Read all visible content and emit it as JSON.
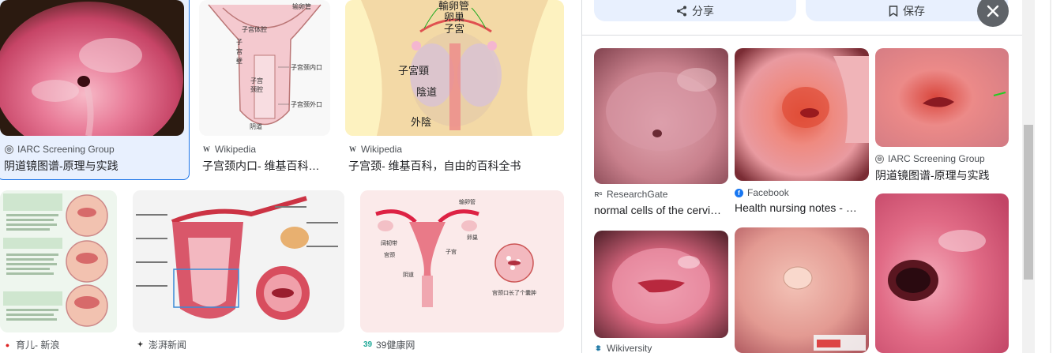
{
  "results": [
    {
      "source": "IARC Screening Group",
      "title": "阴道镜图谱-原理与实践",
      "source_icon": "globe-icon"
    },
    {
      "source": "Wikipedia",
      "title": "子宫颈内口- 维基百科…",
      "source_icon": "wikipedia-icon",
      "labels": [
        "输卵管",
        "子宫体腔",
        "子",
        "宫",
        "壁",
        "子宫颈内口",
        "子",
        "宫",
        "颈",
        "腔",
        "子宫颈外口",
        "阴道"
      ]
    },
    {
      "source": "Wikipedia",
      "title": "子宫颈- 维基百科，自由的百科全书",
      "source_icon": "wikipedia-icon",
      "labels": [
        "輸卵管",
        "卵巢",
        "子宮",
        "子宮頸",
        "陰道",
        "外陰"
      ]
    },
    {
      "source": "育儿- 新浪",
      "title": "",
      "source_icon": "sina-icon"
    },
    {
      "source": "澎湃新闻",
      "title": "",
      "source_icon": "thepaper-icon"
    },
    {
      "source": "39健康网",
      "title": "",
      "source_icon": "39-icon",
      "labels": [
        "输卵管",
        "卵巢",
        "阔韧带",
        "宫颈",
        "阴道",
        "子宫",
        "宫颈口长了个囊肿"
      ]
    }
  ],
  "panel": {
    "share_label": "分享",
    "save_label": "保存",
    "related": [
      {
        "source": "ResearchGate",
        "title": "normal cells of the cervi…",
        "source_icon": "researchgate-icon"
      },
      {
        "source": "Facebook",
        "title": "Health nursing notes - …",
        "source_icon": "facebook-icon"
      },
      {
        "source": "IARC Screening Group",
        "title": "阴道镜图谱-原理与实践",
        "source_icon": "globe-icon"
      },
      {
        "source": "Wikiversity",
        "title": "",
        "source_icon": "wikiversity-icon"
      }
    ]
  },
  "colors": {
    "accent": "#1a73e8",
    "panel_button": "#e8f0fe",
    "close_bg": "#5f6368"
  }
}
